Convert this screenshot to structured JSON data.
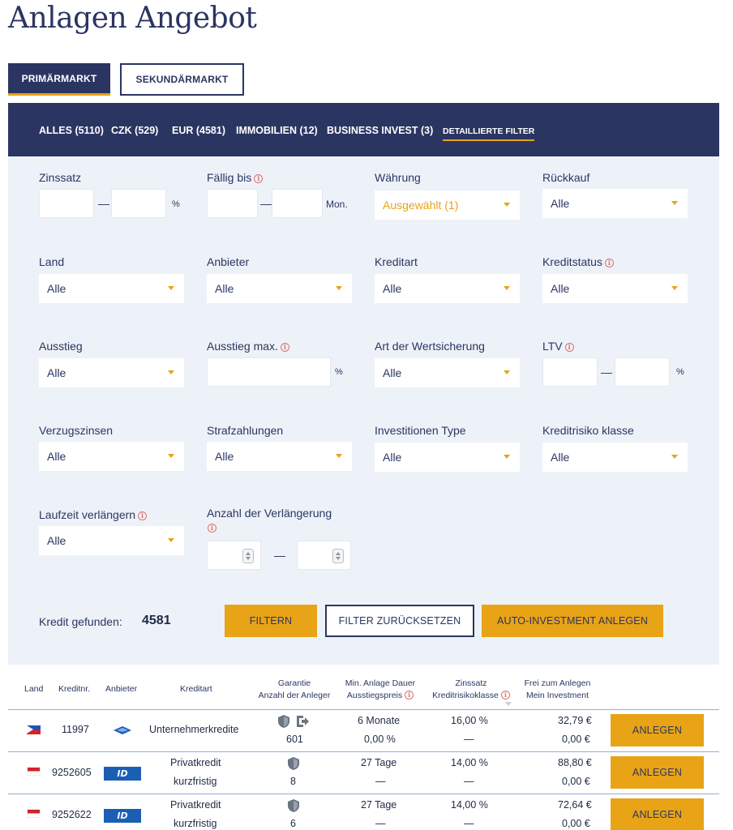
{
  "page": {
    "title": "Anlagen Angebot"
  },
  "market_tabs": [
    {
      "label": "PRIMÄRMARKT",
      "active": true
    },
    {
      "label": "SEKUNDÄRMARKT",
      "active": false
    }
  ],
  "filter_tabs": [
    {
      "label": "ALLES (5110)"
    },
    {
      "label": "CZK (529)"
    },
    {
      "label": "EUR (4581)"
    },
    {
      "label": "IMMOBILIEN (12)"
    },
    {
      "label": "BUSINESS INVEST (3)"
    },
    {
      "label": "DETAILLIERTE FILTER"
    }
  ],
  "filters": {
    "zinssatz": {
      "label": "Zinssatz",
      "unit": "%",
      "dash": "—"
    },
    "faellig_bis": {
      "label": "Fällig bis",
      "unit": "Mon.",
      "dash": "—"
    },
    "waehrung": {
      "label": "Währung",
      "value": "Ausgewählt (1)"
    },
    "rueckkauf": {
      "label": "Rückkauf",
      "value": "Alle"
    },
    "land": {
      "label": "Land",
      "value": "Alle"
    },
    "anbieter": {
      "label": "Anbieter",
      "value": "Alle"
    },
    "kreditart": {
      "label": "Kreditart",
      "value": "Alle"
    },
    "kreditstatus": {
      "label": "Kreditstatus",
      "value": "Alle"
    },
    "ausstieg": {
      "label": "Ausstieg",
      "value": "Alle"
    },
    "ausstieg_max": {
      "label": "Ausstieg max.",
      "unit": "%"
    },
    "art_wertsicherung": {
      "label": "Art der Wertsicherung",
      "value": "Alle"
    },
    "ltv": {
      "label": "LTV",
      "unit": "%",
      "dash": "—"
    },
    "verzugszinsen": {
      "label": "Verzugszinsen",
      "value": "Alle"
    },
    "strafzahlungen": {
      "label": "Strafzahlungen",
      "value": "Alle"
    },
    "investitionen_type": {
      "label": "Investitionen Type",
      "value": "Alle"
    },
    "kreditrisiko_klasse": {
      "label": "Kreditrisiko klasse",
      "value": "Alle"
    },
    "laufzeit_verlaengern": {
      "label": "Laufzeit verlängern",
      "value": "Alle"
    },
    "anzahl_verlaengerung": {
      "label": "Anzahl der Verlängerung",
      "dash": "—"
    },
    "info_glyph": "i"
  },
  "result": {
    "found_label": "Kredit gefunden:",
    "found_count": "4581",
    "filter_button": "FILTERN",
    "reset_button": "FILTER ZURÜCKSETZEN",
    "auto_button": "AUTO-INVESTMENT ANLEGEN"
  },
  "table": {
    "headers": {
      "land": "Land",
      "kreditnr": "Kreditnr.",
      "anbieter": "Anbieter",
      "kreditart": "Kreditart",
      "garantie_1": "Garantie",
      "garantie_2": "Anzahl der Anleger",
      "dauer_1": "Min. Anlage Dauer",
      "dauer_2": "Ausstiegspreis",
      "zins_1": "Zinssatz",
      "zins_2": "Kreditrisikoklasse",
      "frei_1": "Frei zum Anlegen",
      "frei_2": "Mein Investment"
    },
    "rows": [
      {
        "country_flag": "philippines-flag",
        "kreditnr": "11997",
        "provider_logo": "provider-logo-ph",
        "kreditart": "Unternehmerkredite",
        "kreditart_2": "",
        "icons": [
          "shield-icon",
          "exit-icon"
        ],
        "anleger": "601",
        "dauer": "6 Monate",
        "ausstiegspreis": "0,00 %",
        "zinssatz": "16,00 %",
        "risikoklasse": "—",
        "frei": "32,79 €",
        "investment": "0,00 €",
        "button": "ANLEGEN"
      },
      {
        "country_flag": "indonesia-flag",
        "kreditnr": "9252605",
        "provider_logo": "provider-logo-id",
        "provider_logo_text": "ID",
        "kreditart": "Privatkredit",
        "kreditart_2": "kurzfristig",
        "icons": [
          "shield-icon"
        ],
        "anleger": "8",
        "dauer": "27 Tage",
        "ausstiegspreis": "—",
        "zinssatz": "14,00 %",
        "risikoklasse": "—",
        "frei": "88,80 €",
        "investment": "0,00 €",
        "button": "ANLEGEN"
      },
      {
        "country_flag": "indonesia-flag",
        "kreditnr": "9252622",
        "provider_logo": "provider-logo-id",
        "provider_logo_text": "ID",
        "kreditart": "Privatkredit",
        "kreditart_2": "kurzfristig",
        "icons": [
          "shield-icon"
        ],
        "anleger": "6",
        "dauer": "27 Tage",
        "ausstiegspreis": "—",
        "zinssatz": "14,00 %",
        "risikoklasse": "—",
        "frei": "72,64 €",
        "investment": "0,00 €",
        "button": "ANLEGEN"
      }
    ]
  },
  "colors": {
    "navy": "#2b3562",
    "accent": "#e8a317",
    "panel": "#edf2f8",
    "info_red": "#e07070"
  }
}
